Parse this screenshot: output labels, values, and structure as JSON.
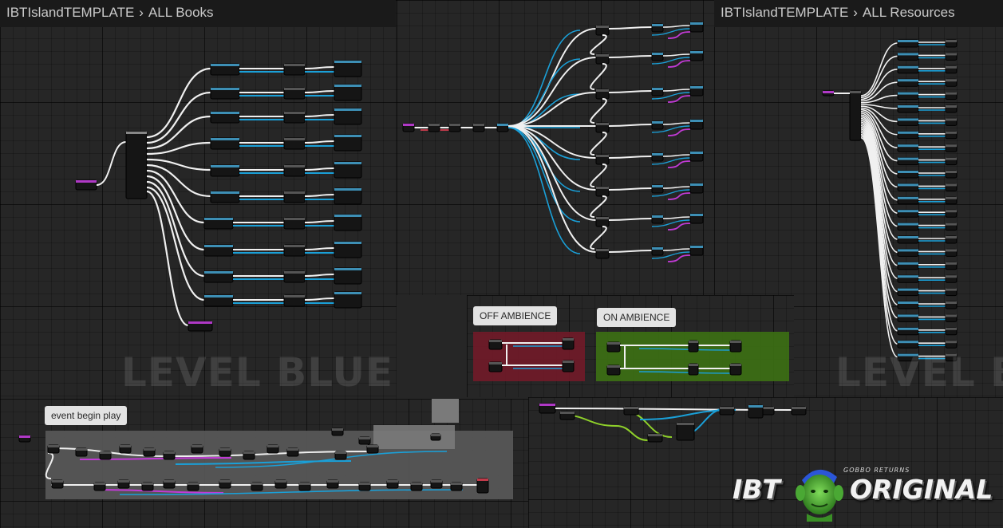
{
  "panels": {
    "books": {
      "breadcrumb_root": "IBTIslandTEMPLATE",
      "breadcrumb_leaf": "ALL Books",
      "watermark": "LEVEL BLUEPRINT"
    },
    "resources": {
      "breadcrumb_root": "IBTIslandTEMPLATE",
      "breadcrumb_leaf": "ALL Resources",
      "watermark": "LEVEL BL"
    }
  },
  "comments": {
    "off_ambience": "OFF AMBIENCE",
    "on_ambience": "ON AMBIENCE",
    "event_begin_play": "event begin play"
  },
  "logo": {
    "left": "IBT",
    "sub": "GOBBO RETURNS",
    "right": "ORIGINAL"
  },
  "colors": {
    "exec_wire": "#f0f0f0",
    "object_wire": "#1aa0d8",
    "purple_wire": "#c23ad6",
    "green_wire": "#8fd12a",
    "off_comment": "#6e1a28",
    "on_comment": "#3b6d14",
    "grid_bg": "#262626",
    "node_body": "#151515"
  },
  "icons": [
    "chevron-right-icon",
    "goblin-mascot-icon"
  ]
}
